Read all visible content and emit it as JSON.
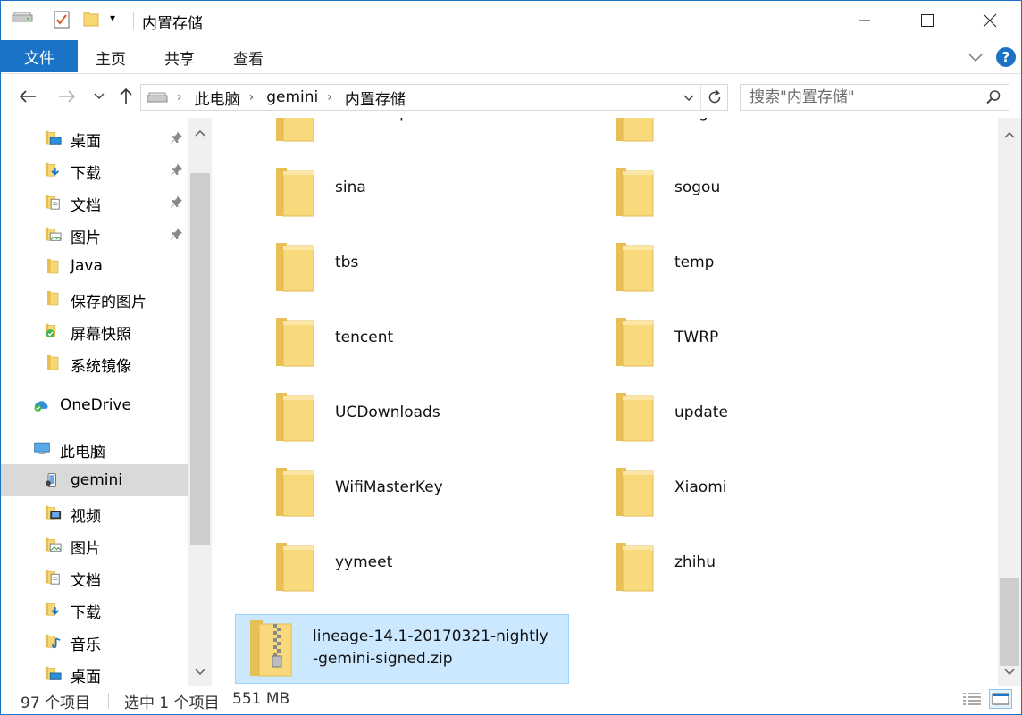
{
  "window": {
    "title": "内置存储",
    "minimize_icon": "minimize-icon",
    "maximize_icon": "maximize-icon",
    "close_icon": "close-icon"
  },
  "ribbon": {
    "tabs": [
      {
        "label": "文件"
      },
      {
        "label": "主页"
      },
      {
        "label": "共享"
      },
      {
        "label": "查看"
      }
    ],
    "help_label": "?"
  },
  "address": {
    "breadcrumb": [
      "此电脑",
      "gemini",
      "内置存储"
    ]
  },
  "search": {
    "placeholder": "搜索\"内置存储\""
  },
  "nav": {
    "items": [
      {
        "label": "桌面",
        "icon": "desktop-folder-icon",
        "pinned": true
      },
      {
        "label": "下载",
        "icon": "download-folder-icon",
        "pinned": true
      },
      {
        "label": "文档",
        "icon": "documents-folder-icon",
        "pinned": true
      },
      {
        "label": "图片",
        "icon": "pictures-folder-icon",
        "pinned": true
      },
      {
        "label": "Java",
        "icon": "folder-icon"
      },
      {
        "label": "保存的图片",
        "icon": "folder-icon"
      },
      {
        "label": "屏幕快照",
        "icon": "synced-folder-icon"
      },
      {
        "label": "系统镜像",
        "icon": "folder-icon"
      },
      {
        "label": "OneDrive",
        "icon": "onedrive-icon"
      },
      {
        "label": "此电脑",
        "icon": "this-pc-icon"
      },
      {
        "label": "gemini",
        "icon": "phone-icon"
      },
      {
        "label": "视频",
        "icon": "videos-folder-icon"
      },
      {
        "label": "图片",
        "icon": "pictures-folder-icon"
      },
      {
        "label": "文档",
        "icon": "documents-folder-icon"
      },
      {
        "label": "下载",
        "icon": "download-folder-icon"
      },
      {
        "label": "音乐",
        "icon": "music-folder-icon"
      },
      {
        "label": "桌面",
        "icon": "desktop-folder-icon"
      }
    ]
  },
  "files": [
    {
      "name": "ramdump",
      "type": "folder"
    },
    {
      "name": "Ringtones",
      "type": "folder"
    },
    {
      "name": "sina",
      "type": "folder"
    },
    {
      "name": "sogou",
      "type": "folder"
    },
    {
      "name": "tbs",
      "type": "folder"
    },
    {
      "name": "temp",
      "type": "folder"
    },
    {
      "name": "tencent",
      "type": "folder"
    },
    {
      "name": "TWRP",
      "type": "folder"
    },
    {
      "name": "UCDownloads",
      "type": "folder"
    },
    {
      "name": "update",
      "type": "folder"
    },
    {
      "name": "WifiMasterKey",
      "type": "folder"
    },
    {
      "name": "Xiaomi",
      "type": "folder"
    },
    {
      "name": "yymeet",
      "type": "folder"
    },
    {
      "name": "zhihu",
      "type": "folder"
    },
    {
      "name_line1": "lineage-14.1-20170321-nightly",
      "name_line2": "-gemini-signed.zip",
      "type": "zip",
      "selected": true
    }
  ],
  "status": {
    "item_count": "97 个项目",
    "selection": "选中 1 个项目",
    "size": "551 MB"
  },
  "colors": {
    "accent": "#1a73c6",
    "folder": "#f7d774",
    "selection_bg": "#cce8ff"
  }
}
